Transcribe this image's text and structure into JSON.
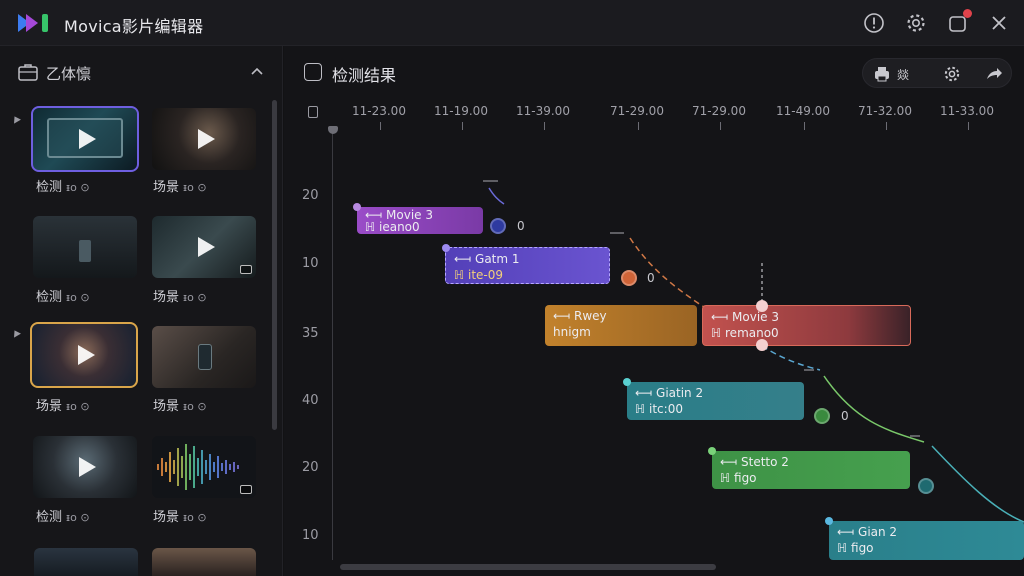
{
  "app": {
    "title": "Movica影片编辑器"
  },
  "titlebar": {
    "icons": [
      "info-icon",
      "gear-icon",
      "notification-icon",
      "close-icon"
    ],
    "notif_color": "#e0434b"
  },
  "left_panel": {
    "title": "乙体懔",
    "items": [
      {
        "label": "检测",
        "sub": "ᵻo ⊙"
      },
      {
        "label": "场景",
        "sub": "ᵻo ⊙"
      },
      {
        "label": "检测",
        "sub": "ᵻo ⊙"
      },
      {
        "label": "场景",
        "sub": "ᵻo ⊙"
      },
      {
        "label": "场景",
        "sub": "ᵻo ⊙"
      },
      {
        "label": "场景",
        "sub": "ᵻo ⊙"
      },
      {
        "label": "检测",
        "sub": "ᵻo ⊙"
      },
      {
        "label": "场景",
        "sub": "ᵻo ⊙"
      }
    ]
  },
  "main": {
    "title": "检测结果",
    "toolbar": {
      "a_label": "燚",
      "icons": [
        "print-icon",
        "gear-icon",
        "share-icon"
      ]
    },
    "ruler": [
      "11-23.00",
      "11-19.00",
      "11-39.00",
      "71-29.00",
      "71-29.00",
      "11-49.00",
      "71-32.00",
      "11-33.00"
    ],
    "y_labels": [
      "20",
      "10",
      "35",
      "40",
      "20",
      "10"
    ],
    "clips": [
      {
        "name": "⟻ Movie 3",
        "meta": "ℍ ieano0",
        "color": "#8a44b8"
      },
      {
        "name": "⟻ Gatm 1",
        "meta": "ℍ ite-09",
        "color": "#5b46b6"
      },
      {
        "name": "⟻ Rwey",
        "meta": "hnigm",
        "color": "#b8792a"
      },
      {
        "name": "⟻ Movie 3",
        "meta": "ℍ remano0",
        "color": "#b2464a"
      },
      {
        "name": "⟻ Giatin 2",
        "meta": "ℍ itc:00",
        "color": "#2b7d86"
      },
      {
        "name": "⟻ Stetto 2",
        "meta": "ℍ figo",
        "color": "#3f8f45"
      },
      {
        "name": "⟻ Gian 2",
        "meta": "ℍ figo",
        "color": "#2b7f8a"
      }
    ],
    "nodes": [
      "0",
      "0",
      "0"
    ]
  }
}
